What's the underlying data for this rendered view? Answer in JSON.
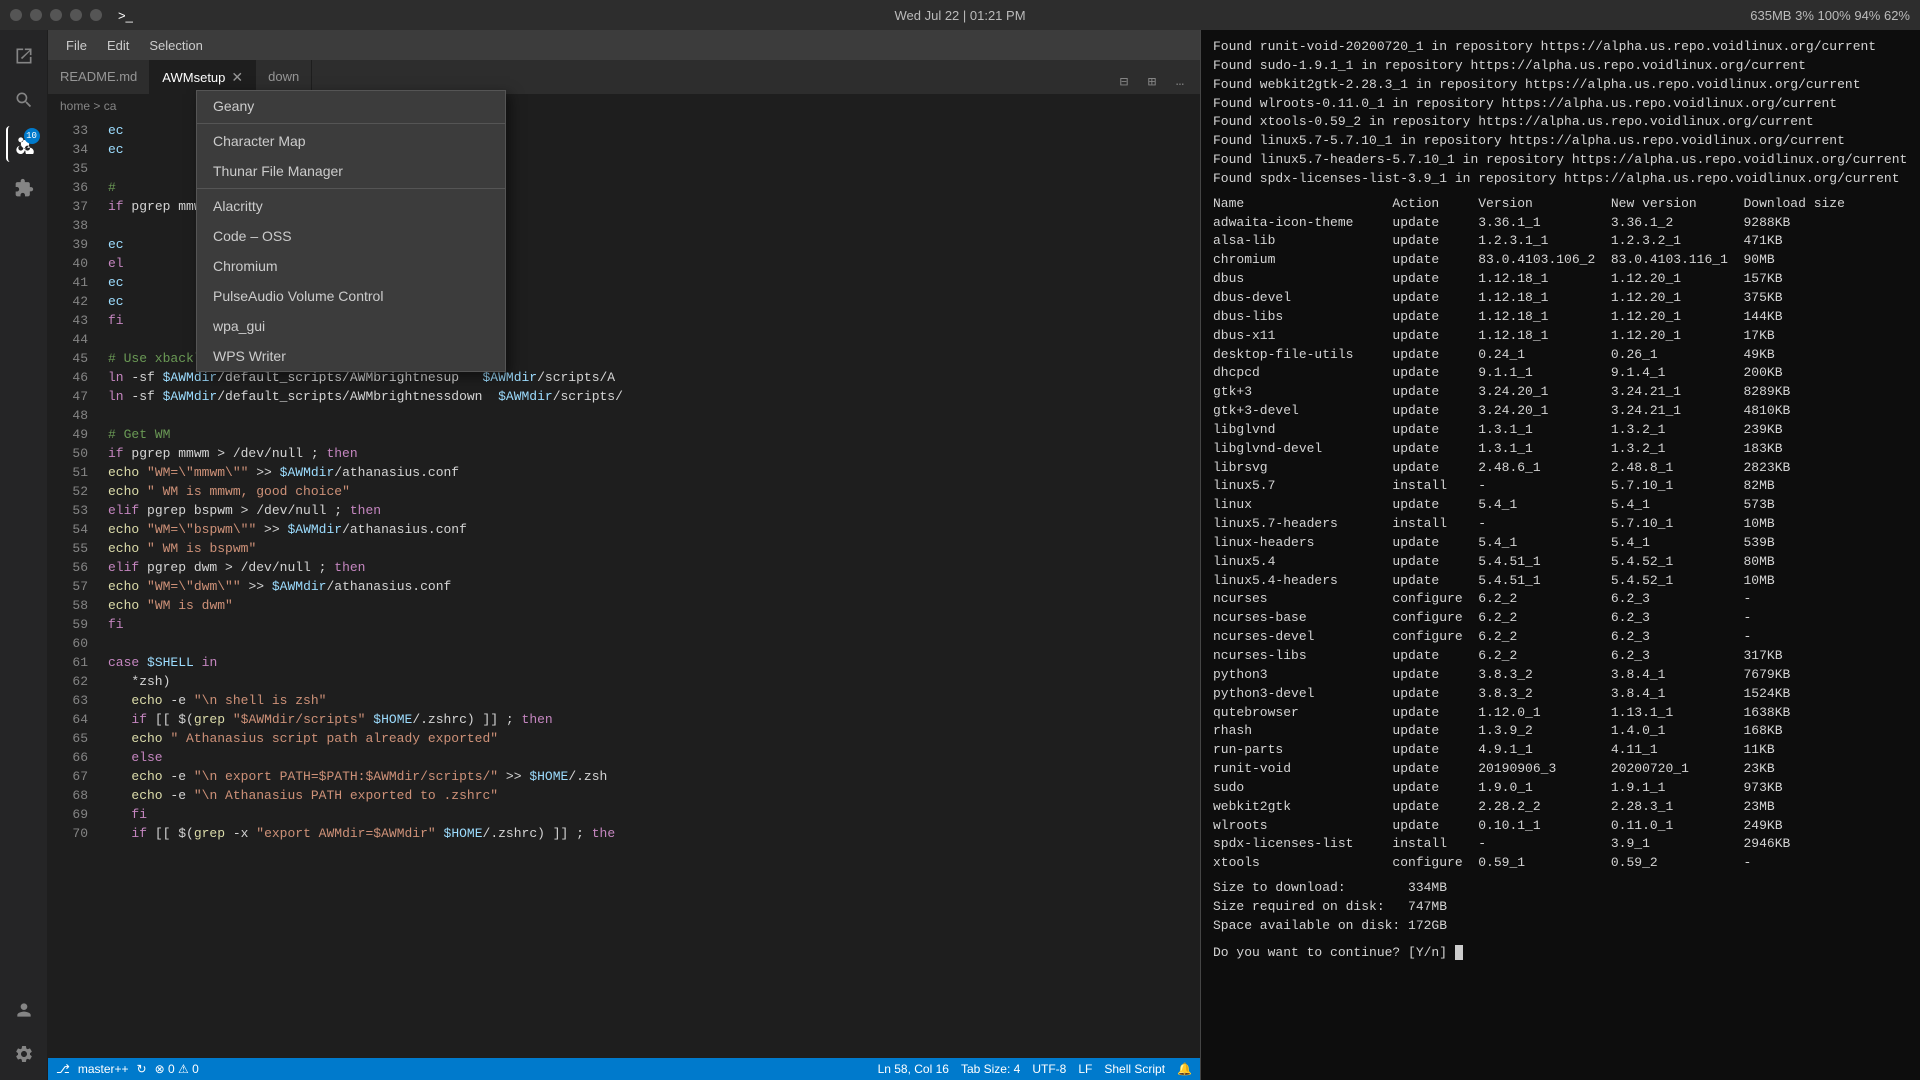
{
  "topbar": {
    "dots": [
      "dot1",
      "dot2",
      "dot3",
      "dot4",
      "dot5"
    ],
    "prompt": ">_",
    "datetime": "Wed Jul 22  |  01:21 PM",
    "stats": "635MB  3%  100%  94%  62%"
  },
  "menubar": {
    "items": [
      "File",
      "Edit",
      "Selection"
    ]
  },
  "tabs": [
    {
      "label": "README.md",
      "active": false,
      "closeable": false
    },
    {
      "label": "AWMsetup",
      "active": true,
      "closeable": true
    },
    {
      "label": "down",
      "active": false,
      "closeable": false
    }
  ],
  "breadcrumb": {
    "path": "home > ca"
  },
  "dropdown": {
    "items": [
      {
        "label": "Geany",
        "type": "item"
      },
      {
        "type": "separator"
      },
      {
        "label": "Character Map",
        "type": "item"
      },
      {
        "label": "Thunar File Manager",
        "type": "item"
      },
      {
        "type": "separator"
      },
      {
        "label": "Alacritty",
        "type": "item"
      },
      {
        "label": "Code – OSS",
        "type": "item"
      },
      {
        "label": "Chromium",
        "type": "item"
      },
      {
        "label": "PulseAudio Volume Control",
        "type": "item"
      },
      {
        "label": "wpa_gui",
        "type": "item"
      },
      {
        "label": "WPS Writer",
        "type": "item"
      }
    ]
  },
  "editor": {
    "lines": [
      {
        "num": "33",
        "code": "ec"
      },
      {
        "num": "34",
        "code": "ec"
      },
      {
        "num": "35",
        "code": ""
      },
      {
        "num": "36",
        "code": "#"
      },
      {
        "num": "37",
        "code": "if pgrep mmwm > /dev/null ; then"
      },
      {
        "num": "38",
        "code": ""
      },
      {
        "num": "39",
        "code": "ec"
      },
      {
        "num": "40",
        "code": "el"
      },
      {
        "num": "41",
        "code": "ec"
      },
      {
        "num": "42",
        "code": "ec  athanasius.conf"
      },
      {
        "num": "43",
        "code": "fi"
      },
      {
        "num": "44",
        "code": ""
      },
      {
        "num": "45",
        "code": "# Use xbacklight to change brightness"
      },
      {
        "num": "46",
        "code": "ln -sf $AWMdir/default_scripts/AWMbrightnesup   $AWMdir/scripts/A"
      },
      {
        "num": "47",
        "code": "ln -sf $AWMdir/default_scripts/AWMbrightnessdown  $AWMdir/scripts/"
      },
      {
        "num": "48",
        "code": ""
      },
      {
        "num": "49",
        "code": "# Get WM"
      },
      {
        "num": "50",
        "code": "if pgrep mmwm > /dev/null ; then"
      },
      {
        "num": "51",
        "code": "echo \"WM=\\\"mmwm\\\"\" >> $AWMdir/athanasius.conf"
      },
      {
        "num": "52",
        "code": "echo \" WM is mmwm, good choice\""
      },
      {
        "num": "53",
        "code": "elif pgrep bspwm > /dev/null ; then"
      },
      {
        "num": "54",
        "code": "echo \"WM=\\\"bspwm\\\"\" >> $AWMdir/athanasius.conf"
      },
      {
        "num": "55",
        "code": "echo \" WM is bspwm\""
      },
      {
        "num": "56",
        "code": "elif pgrep dwm > /dev/null ; then"
      },
      {
        "num": "57",
        "code": "echo \"WM=\\\"dwm\\\"\" >> $AWMdir/athanasius.conf"
      },
      {
        "num": "58",
        "code": "echo \"WM is dwm\""
      },
      {
        "num": "59",
        "code": "fi"
      },
      {
        "num": "60",
        "code": ""
      },
      {
        "num": "61",
        "code": "case $SHELL in"
      },
      {
        "num": "62",
        "code": "   *zsh)"
      },
      {
        "num": "63",
        "code": "   echo -e \"\\n shell is zsh\""
      },
      {
        "num": "64",
        "code": "   if [[ $(grep \"$AWMdir/scripts\" $HOME/.zshrc) ]] ; then"
      },
      {
        "num": "65",
        "code": "   echo \" Athanasius script path already exported\""
      },
      {
        "num": "66",
        "code": "   else"
      },
      {
        "num": "67",
        "code": "   echo -e \"\\n export PATH=$PATH:$AWMdir/scripts/\" >> $HOME/.zsh"
      },
      {
        "num": "68",
        "code": "   echo -e \"\\n Athanasius PATH exported to .zshrc\""
      },
      {
        "num": "69",
        "code": "   fi"
      },
      {
        "num": "70",
        "code": "   if [[ $(grep -x \"export AWMdir=$AWMdir\" $HOME/.zshrc) ]] ; the"
      }
    ]
  },
  "terminal": {
    "found_lines": [
      "Found runit-void-20200720_1 in repository https://alpha.us.repo.voidlinux.org/current",
      "Found sudo-1.9.1_1 in repository https://alpha.us.repo.voidlinux.org/current",
      "Found webkit2gtk-2.28.3_1 in repository https://alpha.us.repo.voidlinux.org/current",
      "Found wlroots-0.11.0_1 in repository https://alpha.us.repo.voidlinux.org/current",
      "Found xtools-0.59_2 in repository https://alpha.us.repo.voidlinux.org/current",
      "Found linux5.7-5.7.10_1 in repository https://alpha.us.repo.voidlinux.org/current",
      "Found linux5.7-headers-5.7.10_1 in repository https://alpha.us.repo.voidlinux.org/current",
      "Found spdx-licenses-list-3.9_1 in repository https://alpha.us.repo.voidlinux.org/current"
    ],
    "table_header": "Name                   Action     Version          New version      Download size",
    "packages": [
      {
        "name": "adwaita-icon-theme",
        "action": "update",
        "version": "3.36.1_1",
        "new_version": "3.36.1_2",
        "size": "9288KB"
      },
      {
        "name": "alsa-lib",
        "action": "update",
        "version": "1.2.3.1_1",
        "new_version": "1.2.3.2_1",
        "size": "471KB"
      },
      {
        "name": "chromium",
        "action": "update",
        "version": "83.0.4103.106_2",
        "new_version": "83.0.4103.116_1",
        "size": "90MB"
      },
      {
        "name": "dbus",
        "action": "update",
        "version": "1.12.18_1",
        "new_version": "1.12.20_1",
        "size": "157KB"
      },
      {
        "name": "dbus-devel",
        "action": "update",
        "version": "1.12.18_1",
        "new_version": "1.12.20_1",
        "size": "375KB"
      },
      {
        "name": "dbus-libs",
        "action": "update",
        "version": "1.12.18_1",
        "new_version": "1.12.20_1",
        "size": "144KB"
      },
      {
        "name": "dbus-x11",
        "action": "update",
        "version": "1.12.18_1",
        "new_version": "1.12.20_1",
        "size": "17KB"
      },
      {
        "name": "desktop-file-utils",
        "action": "update",
        "version": "0.24_1",
        "new_version": "0.26_1",
        "size": "49KB"
      },
      {
        "name": "dhcpcd",
        "action": "update",
        "version": "9.1.1_1",
        "new_version": "9.1.4_1",
        "size": "200KB"
      },
      {
        "name": "gtk+3",
        "action": "update",
        "version": "3.24.20_1",
        "new_version": "3.24.21_1",
        "size": "8289KB"
      },
      {
        "name": "gtk+3-devel",
        "action": "update",
        "version": "3.24.20_1",
        "new_version": "3.24.21_1",
        "size": "4810KB"
      },
      {
        "name": "libglvnd",
        "action": "update",
        "version": "1.3.1_1",
        "new_version": "1.3.2_1",
        "size": "239KB"
      },
      {
        "name": "libglvnd-devel",
        "action": "update",
        "version": "1.3.1_1",
        "new_version": "1.3.2_1",
        "size": "183KB"
      },
      {
        "name": "librsvg",
        "action": "update",
        "version": "2.48.6_1",
        "new_version": "2.48.8_1",
        "size": "2823KB"
      },
      {
        "name": "linux5.7",
        "action": "install",
        "version": "-",
        "new_version": "5.7.10_1",
        "size": "82MB"
      },
      {
        "name": "linux",
        "action": "update",
        "version": "5.4_1",
        "new_version": "5.4_1",
        "size": "573B"
      },
      {
        "name": "linux5.7-headers",
        "action": "install",
        "version": "-",
        "new_version": "5.7.10_1",
        "size": "10MB"
      },
      {
        "name": "linux-headers",
        "action": "update",
        "version": "5.4_1",
        "new_version": "5.4_1",
        "size": "539B"
      },
      {
        "name": "linux5.4",
        "action": "update",
        "version": "5.4.51_1",
        "new_version": "5.4.52_1",
        "size": "80MB"
      },
      {
        "name": "linux5.4-headers",
        "action": "update",
        "version": "5.4.51_1",
        "new_version": "5.4.52_1",
        "size": "10MB"
      },
      {
        "name": "ncurses",
        "action": "configure",
        "version": "6.2_2",
        "new_version": "6.2_3",
        "size": "-"
      },
      {
        "name": "ncurses-base",
        "action": "configure",
        "version": "6.2_2",
        "new_version": "6.2_3",
        "size": "-"
      },
      {
        "name": "ncurses-devel",
        "action": "configure",
        "version": "6.2_2",
        "new_version": "6.2_3",
        "size": "-"
      },
      {
        "name": "ncurses-libs",
        "action": "update",
        "version": "6.2_2",
        "new_version": "6.2_3",
        "size": "317KB"
      },
      {
        "name": "python3",
        "action": "update",
        "version": "3.8.3_2",
        "new_version": "3.8.4_1",
        "size": "7679KB"
      },
      {
        "name": "python3-devel",
        "action": "update",
        "version": "3.8.3_2",
        "new_version": "3.8.4_1",
        "size": "1524KB"
      },
      {
        "name": "qutebrowser",
        "action": "update",
        "version": "1.12.0_1",
        "new_version": "1.13.1_1",
        "size": "1638KB"
      },
      {
        "name": "rhash",
        "action": "update",
        "version": "1.3.9_2",
        "new_version": "1.4.0_1",
        "size": "168KB"
      },
      {
        "name": "run-parts",
        "action": "update",
        "version": "4.9.1_1",
        "new_version": "4.11_1",
        "size": "11KB"
      },
      {
        "name": "runit-void",
        "action": "update",
        "version": "20190906_3",
        "new_version": "20200720_1",
        "size": "23KB"
      },
      {
        "name": "sudo",
        "action": "update",
        "version": "1.9.0_1",
        "new_version": "1.9.1_1",
        "size": "973KB"
      },
      {
        "name": "webkit2gtk",
        "action": "update",
        "version": "2.28.2_2",
        "new_version": "2.28.3_1",
        "size": "23MB"
      },
      {
        "name": "wlroots",
        "action": "update",
        "version": "0.10.1_1",
        "new_version": "0.11.0_1",
        "size": "249KB"
      },
      {
        "name": "spdx-licenses-list",
        "action": "install",
        "version": "-",
        "new_version": "3.9_1",
        "size": "2946KB"
      },
      {
        "name": "xtools",
        "action": "configure",
        "version": "0.59_1",
        "new_version": "0.59_2",
        "size": "-"
      }
    ],
    "summary": [
      "Size to download:        334MB",
      "Size required on disk:   747MB",
      "Space available on disk: 172GB"
    ],
    "prompt": "Do you want to continue? [Y/n]"
  },
  "statusbar": {
    "branch": "master++",
    "errors": "0",
    "warnings": "0",
    "line_info": "Ln 58, Col 16",
    "tab_info": "Tab Size: 4",
    "encoding": "UTF-8",
    "eol": "LF",
    "lang": "Shell Script"
  }
}
